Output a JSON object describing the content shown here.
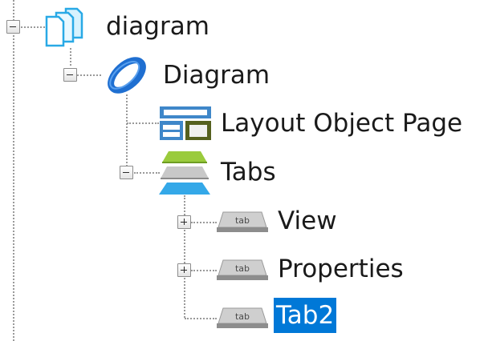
{
  "tree": {
    "nodes": [
      {
        "label": "diagram",
        "icon": "pages-icon",
        "expanded": true
      },
      {
        "label": "Diagram",
        "icon": "diagram-ring-icon",
        "expanded": true
      },
      {
        "label": "Layout Object Page",
        "icon": "layout-page-icon"
      },
      {
        "label": "Tabs",
        "icon": "tabs-stack-icon",
        "expanded": true
      },
      {
        "label": "View",
        "icon": "tab-icon",
        "expanded": false
      },
      {
        "label": "Properties",
        "icon": "tab-icon",
        "expanded": false
      },
      {
        "label": "Tab2",
        "icon": "tab-icon",
        "selected": true
      }
    ],
    "tab_icon_text": "tab",
    "selection_color": "#0078d7"
  }
}
